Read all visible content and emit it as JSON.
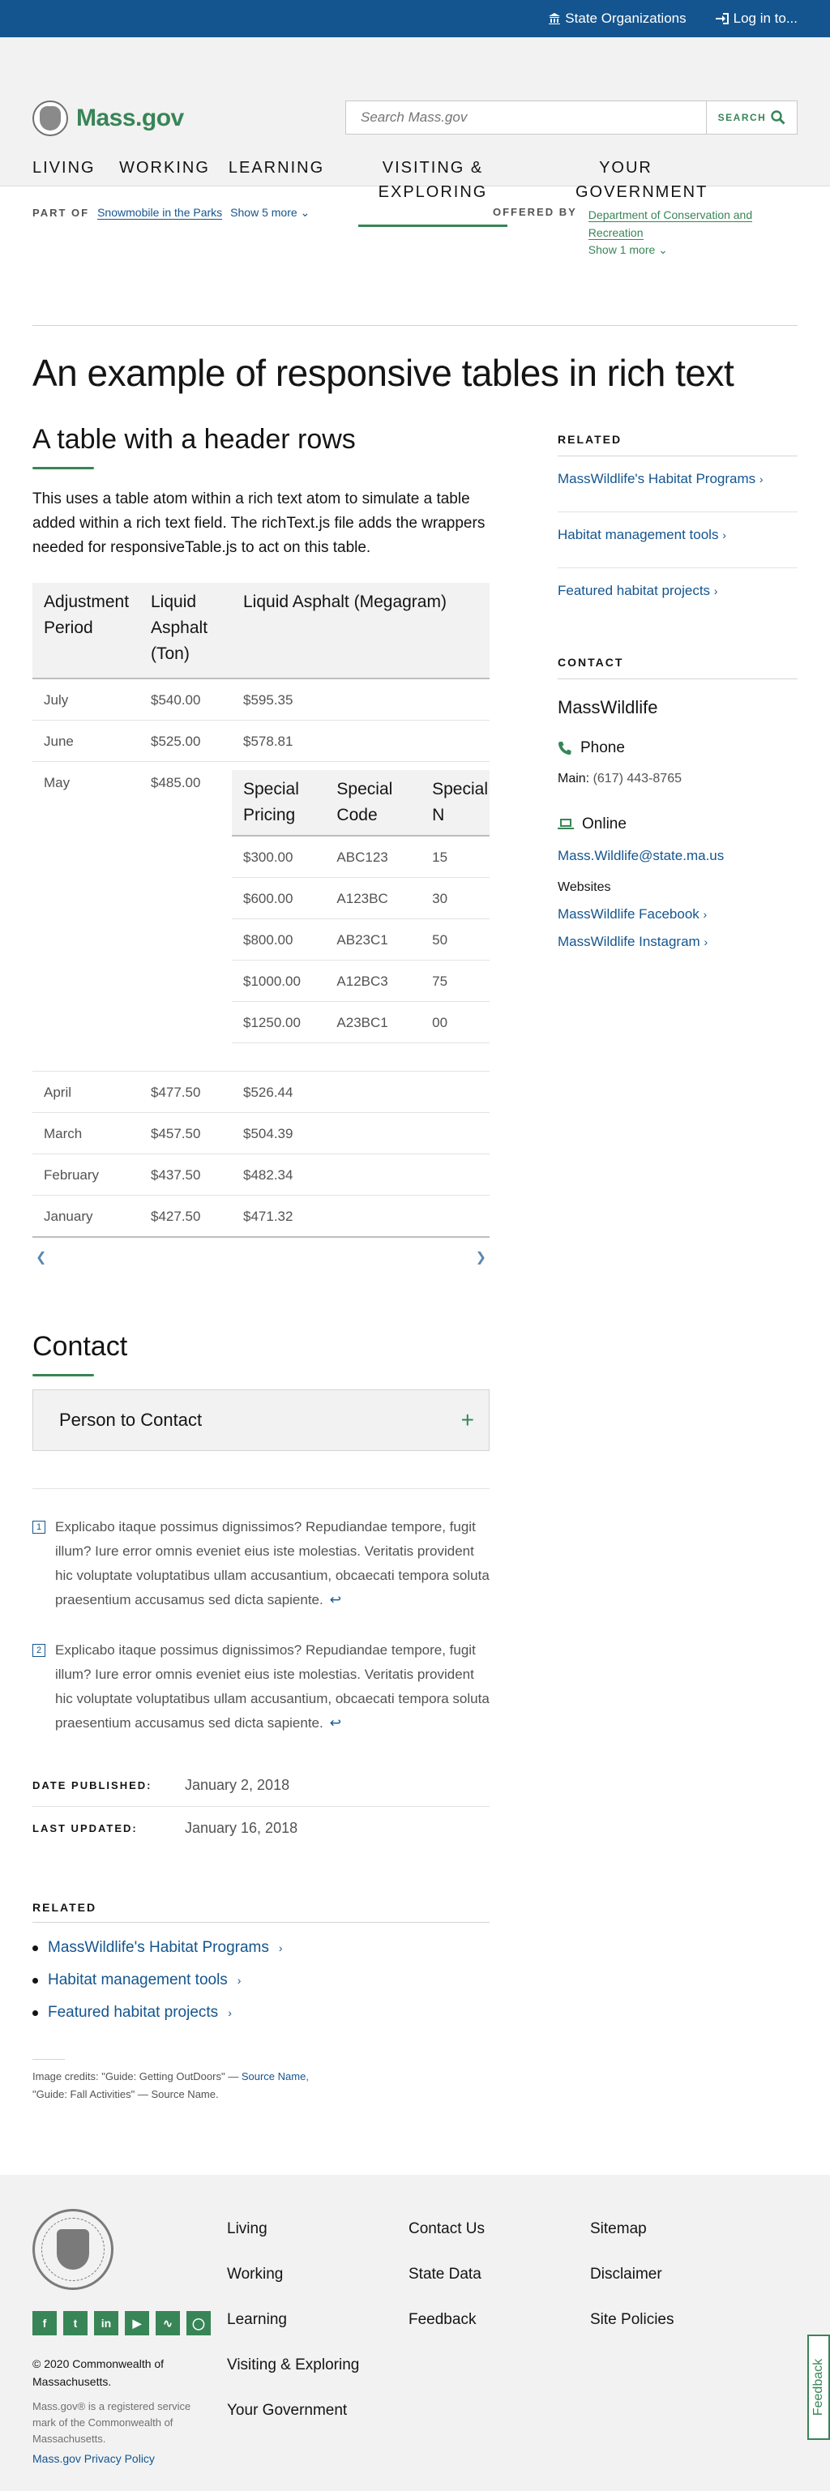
{
  "utility": {
    "state_orgs": "State Organizations",
    "login": "Log in to..."
  },
  "header": {
    "logo_text": "Mass.gov",
    "search_placeholder": "Search Mass.gov",
    "search_button": "SEARCH",
    "nav": [
      {
        "label": "LIVING"
      },
      {
        "label": "WORKING"
      },
      {
        "label": "LEARNING"
      },
      {
        "label": "VISITING & EXPLORING"
      },
      {
        "label": "YOUR GOVERNMENT"
      }
    ]
  },
  "org": {
    "part_of_label": "PART OF",
    "part_of_link": "Snowmobile in the Parks",
    "show_more": "Show 5 more",
    "offered_by_label": "OFFERED BY",
    "offered_by_link": "Department of Conservation and Recreation",
    "show_one_more": "Show 1 more"
  },
  "page_title": "An example of responsive tables in rich text",
  "section_title": "A table with a header rows",
  "intro": "This uses a table atom within a rich text atom to simulate a table added within a rich text field. The richText.js file adds the wrappers needed for responsiveTable.js to act on this table.",
  "table": {
    "headers": [
      "Adjustment Period",
      "Liquid Asphalt (Ton)",
      "Liquid Asphalt (Megagram)"
    ],
    "rows_before": [
      [
        "July",
        "$540.00",
        "$595.35"
      ],
      [
        "June",
        "$525.00",
        "$578.81"
      ]
    ],
    "may_row": {
      "period": "May",
      "ton": "$485.00"
    },
    "inner_headers": [
      "Special Pricing",
      "Special Code",
      "Special N"
    ],
    "inner_rows": [
      [
        "$300.00",
        "ABC123",
        "15"
      ],
      [
        "$600.00",
        "A123BC",
        "30"
      ],
      [
        "$800.00",
        "AB23C1",
        "50"
      ],
      [
        "$1000.00",
        "A12BC3",
        "75"
      ],
      [
        "$1250.00",
        "A23BC1",
        "00"
      ]
    ],
    "rows_after": [
      [
        "April",
        "$477.50",
        "$526.44"
      ],
      [
        "March",
        "$457.50",
        "$504.39"
      ],
      [
        "February",
        "$437.50",
        "$482.34"
      ],
      [
        "January",
        "$427.50",
        "$471.32"
      ]
    ]
  },
  "contact_section": {
    "title": "Contact",
    "accordion_title": "Person to Contact"
  },
  "footnotes": [
    {
      "num": "1",
      "text": "Explicabo itaque possimus dignissimos? Repudiandae tempore, fugit illum? Iure error omnis eveniet eius iste molestias. Veritatis provident hic voluptate voluptatibus ullam accusantium, obcaecati tempora soluta praesentium accusamus sed dicta sapiente."
    },
    {
      "num": "2",
      "text": "Explicabo itaque possimus dignissimos? Repudiandae tempore, fugit illum? Iure error omnis eveniet eius iste molestias. Veritatis provident hic voluptate voluptatibus ullam accusantium, obcaecati tempora soluta praesentium accusamus sed dicta sapiente."
    }
  ],
  "dates": {
    "published_label": "DATE PUBLISHED:",
    "published": "January 2, 2018",
    "updated_label": "LAST UPDATED:",
    "updated": "January 16, 2018"
  },
  "related": {
    "heading": "RELATED",
    "links": [
      "MassWildlife's Habitat Programs",
      "Habitat management tools",
      "Featured habitat projects"
    ]
  },
  "credits": {
    "prefix": "Image credits:",
    "c1": "\"Guide: Getting OutDoors\" —",
    "c1_link": "Source Name",
    "c2": "\"Guide: Fall Activities\" — Source Name."
  },
  "aside": {
    "related_heading": "RELATED",
    "contact_heading": "CONTACT",
    "org_name": "MassWildlife",
    "phone_label": "Phone",
    "main_label": "Main:",
    "phone_number": "(617) 443-8765",
    "online_label": "Online",
    "email": "Mass.Wildlife@state.ma.us",
    "websites_label": "Websites",
    "facebook": "MassWildlife Facebook",
    "instagram": "MassWildlife Instagram"
  },
  "footer": {
    "col1": [
      "Living",
      "Working",
      "Learning",
      "Visiting & Exploring",
      "Your Government"
    ],
    "col2": [
      "Contact Us",
      "State Data",
      "Feedback"
    ],
    "col3": [
      "Sitemap",
      "Disclaimer",
      "Site Policies"
    ],
    "copyright": "© 2020 Commonwealth of Massachusetts.",
    "service_mark": "Mass.gov® is a registered service mark of the Commonwealth of Massachusetts.",
    "privacy": "Mass.gov Privacy Policy",
    "social": [
      "facebook-icon",
      "twitter-icon",
      "linkedin-icon",
      "youtube-icon",
      "rss-icon",
      "instagram-icon"
    ]
  },
  "feedback_tab": "Feedback",
  "colors": {
    "brand_blue": "#14558f",
    "brand_green": "#388557"
  }
}
